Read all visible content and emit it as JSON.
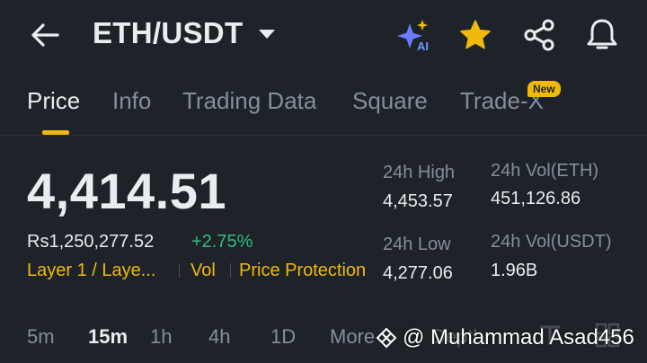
{
  "header": {
    "pair": "ETH/USDT",
    "icons": [
      "back-arrow-icon",
      "ai-sparkle-icon",
      "star-icon",
      "share-icon",
      "bell-icon"
    ],
    "star_color": "#f0b90b"
  },
  "tabs": [
    {
      "label": "Price",
      "active": true
    },
    {
      "label": "Info"
    },
    {
      "label": "Trading Data"
    },
    {
      "label": "Square"
    },
    {
      "label": "Trade-X",
      "badge": "New"
    }
  ],
  "price": {
    "last": "4,414.51",
    "fiat": "Rs1,250,277.52",
    "change": "+2.75%",
    "change_color": "#2ebd85"
  },
  "tags": [
    "Layer 1 / Laye...",
    "Vol",
    "Price Protection"
  ],
  "stats": {
    "high_label": "24h High",
    "high_value": "4,453.57",
    "low_label": "24h Low",
    "low_value": "4,277.06",
    "vol_base_label": "24h Vol(ETH)",
    "vol_base_value": "451,126.86",
    "vol_quote_label": "24h Vol(USDT)",
    "vol_quote_value": "1.96B"
  },
  "intervals": [
    "5m",
    "15m",
    "1h",
    "4h",
    "1D",
    "More",
    "Depth"
  ],
  "active_interval": "15m",
  "watermark": "@ Muhammad Asad456",
  "accent": "#f0b90b"
}
